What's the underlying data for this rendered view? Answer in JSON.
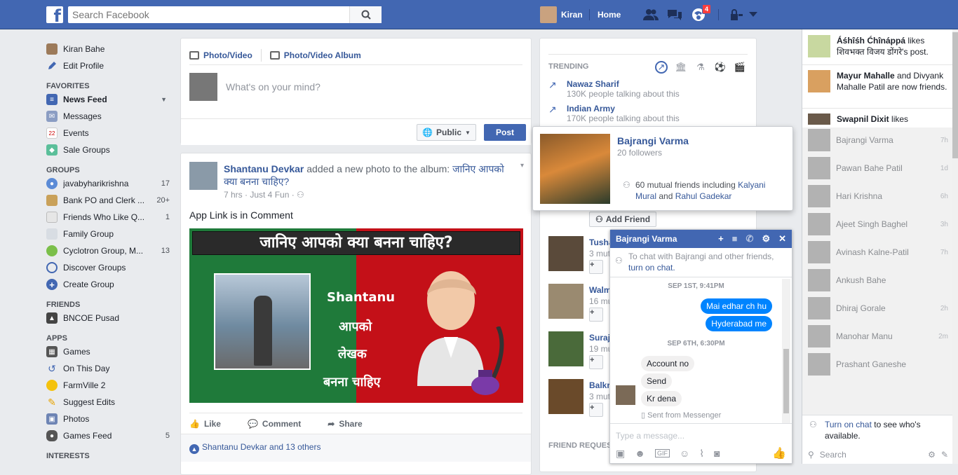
{
  "topbar": {
    "logo": "f",
    "search_placeholder": "Search Facebook",
    "user_name": "Kiran",
    "home_label": "Home",
    "notifications_count": "4",
    "icons": [
      "friend-requests-icon",
      "messages-icon",
      "notifications-icon",
      "privacy-icon",
      "account-menu-icon"
    ]
  },
  "leftnav": {
    "profile": [
      {
        "label": "Kiran Bahe",
        "icon": "avatar"
      },
      {
        "label": "Edit Profile",
        "icon": "pencil-icon"
      }
    ],
    "favorites_head": "FAVORITES",
    "favorites": [
      {
        "label": "News Feed",
        "icon": "news-feed-icon",
        "bold": true,
        "count": ""
      },
      {
        "label": "Messages",
        "icon": "messages-icon",
        "count": ""
      },
      {
        "label": "Events",
        "icon": "calendar-icon",
        "count": ""
      },
      {
        "label": "Sale Groups",
        "icon": "tag-icon",
        "count": ""
      }
    ],
    "groups_head": "GROUPS",
    "groups": [
      {
        "label": "javabyharikrishna",
        "count": "17"
      },
      {
        "label": "Bank PO and Clerk ...",
        "count": "20+"
      },
      {
        "label": "Friends Who Like Q...",
        "count": "1"
      },
      {
        "label": "Family Group",
        "count": ""
      },
      {
        "label": "Cyclotron Group, M...",
        "count": "13"
      },
      {
        "label": "Discover Groups",
        "count": ""
      },
      {
        "label": "Create Group",
        "count": ""
      }
    ],
    "friends_head": "FRIENDS",
    "friends": [
      {
        "label": "BNCOE Pusad",
        "count": ""
      }
    ],
    "apps_head": "APPS",
    "apps": [
      {
        "label": "Games",
        "count": ""
      },
      {
        "label": "On This Day",
        "count": ""
      },
      {
        "label": "FarmVille 2",
        "count": ""
      },
      {
        "label": "Suggest Edits",
        "count": ""
      },
      {
        "label": "Photos",
        "count": ""
      },
      {
        "label": "Games Feed",
        "count": "5"
      }
    ],
    "interests_head": "INTERESTS"
  },
  "composer": {
    "tab_photo": "Photo/Video",
    "tab_album": "Photo/Video Album",
    "placeholder": "What's on your mind?",
    "audience": "Public",
    "post_label": "Post"
  },
  "post": {
    "author": "Shantanu Devkar",
    "action": " added a new photo to the album: ",
    "album": "जानिए आपको क्या बनना चाहिए?",
    "time": "7 hrs · Just 4 Fun ·",
    "text": "App Link is in Comment",
    "image_banner": "जानिए आपको क्या बनना चाहिए?",
    "image_name": "Shantanu",
    "image_line1": "आपको",
    "image_line2": "लेखक",
    "image_line3": "बनना चाहिए",
    "like": "Like",
    "comment": "Comment",
    "share": "Share",
    "likes_summary": "Shantanu Devkar and 13 others"
  },
  "trending": {
    "head": "TRENDING",
    "items": [
      {
        "title": "Nawaz Sharif",
        "sub": "130K people talking about this"
      },
      {
        "title": "Indian Army",
        "sub": "170K people talking about this"
      }
    ]
  },
  "pymk": [
    {
      "name": "Tusha",
      "mutual": "3 mut"
    },
    {
      "name": "Walm",
      "mutual": "16 mu"
    },
    {
      "name": "Suraj",
      "mutual": "19 mu"
    },
    {
      "name": "Balkr",
      "mutual": "3 mut"
    }
  ],
  "add_friend": "Add Friend",
  "friend_requests_head": "FRIEND REQUES",
  "hovercard": {
    "name": "Bajrangi Varma",
    "followers": "20 followers",
    "mutual_prefix": "60 mutual friends including ",
    "mutual_a": "Kalyani Mural",
    "mutual_and": " and ",
    "mutual_b": "Rahul Gadekar"
  },
  "chat": {
    "title": "Bajrangi Varma",
    "notice": "To chat with Bajrangi and other friends, ",
    "notice_link": "turn on chat.",
    "ts1": "SEP 1ST, 9:41PM",
    "out1": "Mai edhar ch hu",
    "out2": "Hyderabad me",
    "ts2": "SEP 6TH, 6:30PM",
    "in1": "Account no",
    "in2": "Send",
    "in3": "Kr dena",
    "sent": "Sent from Messenger",
    "input_placeholder": "Type a message..."
  },
  "ticker": [
    {
      "name": "Áśhîśh Ćhînáppá",
      "text": " likes शिवभक्त विजय डोंगरे's post."
    },
    {
      "name": "Mayur Mahalle",
      "text": " and Divyank Mahalle Patil are now friends."
    },
    {
      "name": "Swapnil Dixit",
      "text": " likes"
    }
  ],
  "chatlist": [
    {
      "name": "Bajrangi Varma",
      "t": "7h"
    },
    {
      "name": "Pawan Bahe Patil",
      "t": "1d"
    },
    {
      "name": "Hari Krishna",
      "t": "6h"
    },
    {
      "name": "Ajeet Singh Baghel",
      "t": "3h"
    },
    {
      "name": "Avinash Kalne-Patil",
      "t": "7h"
    },
    {
      "name": "Ankush Bahe",
      "t": ""
    },
    {
      "name": "Dhiraj Gorale",
      "t": "2h"
    },
    {
      "name": "Manohar Manu",
      "t": "2m"
    },
    {
      "name": "Prashant Ganeshe",
      "t": ""
    }
  ],
  "sidebar_footer": {
    "turn_on": "Turn on chat",
    "turn_rest": " to see who's available.",
    "search": "Search"
  },
  "colors": {
    "brand": "#4267b2",
    "link": "#365899",
    "messenger": "#0084ff"
  }
}
